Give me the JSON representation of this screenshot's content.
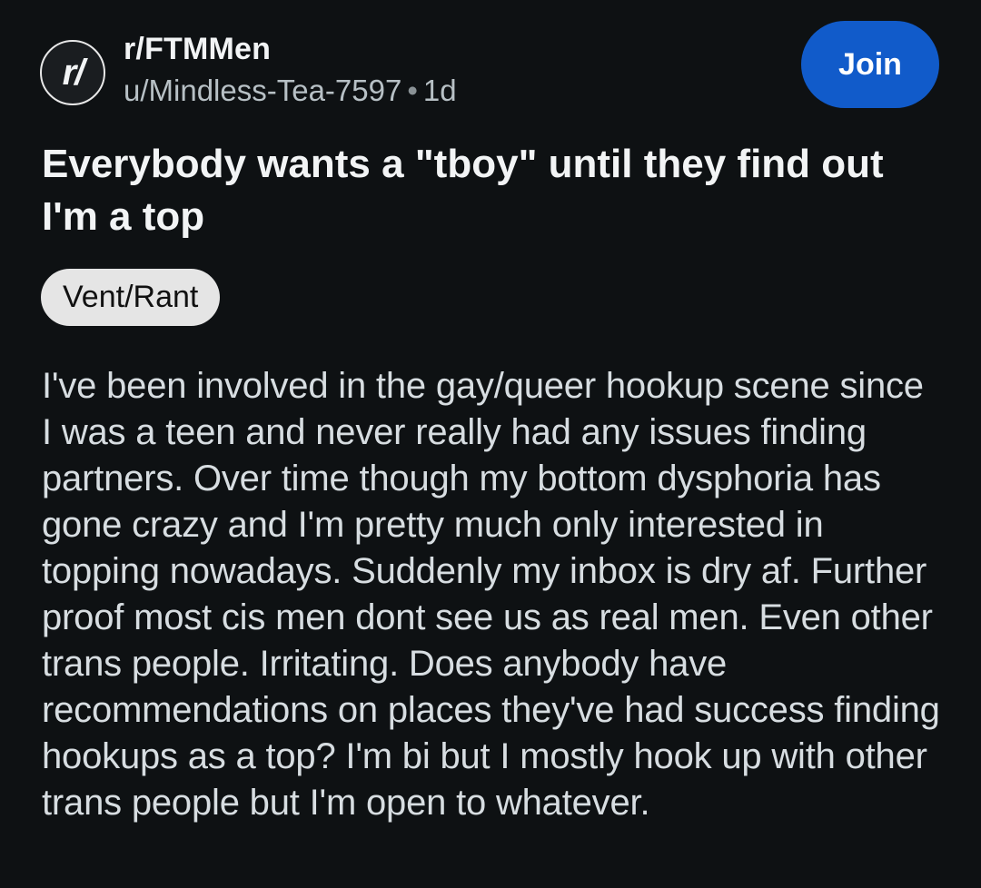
{
  "post": {
    "subreddit": "r/FTMMen",
    "author": "u/Mindless-Tea-7597",
    "separator": "•",
    "age": "1d",
    "join_label": "Join",
    "avatar_glyph": "r/",
    "title": "Everybody wants a \"tboy\" until they find out I'm a top",
    "flair": "Vent/Rant",
    "body": "I've been involved in the gay/queer hookup scene since I was a teen and never really had any issues finding partners. Over time though my bottom dysphoria has gone crazy and I'm pretty much only interested in topping nowadays. Suddenly my inbox is dry af. Further proof most cis men dont see us as real men. Even other trans people. Irritating. Does anybody have recommendations on places they've had success finding hookups as a top? I'm bi but I mostly hook up with other trans people but I'm open to whatever."
  },
  "colors": {
    "background": "#0e1113",
    "join_button": "#115bca",
    "flair_bg": "#e5e5e5",
    "body_text": "#d7dde1",
    "meta_text": "#b7c0c5"
  },
  "icons": {
    "avatar": "subreddit-avatar-icon"
  }
}
